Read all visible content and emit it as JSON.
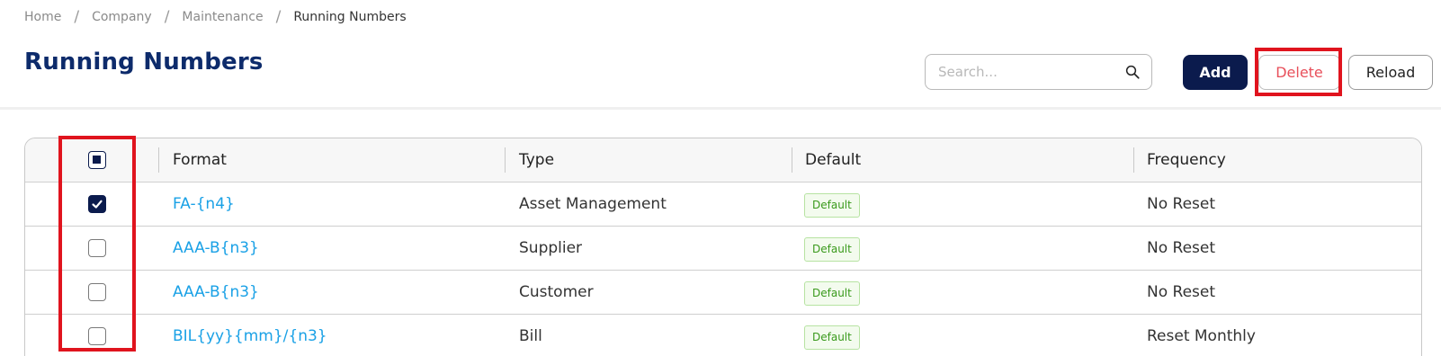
{
  "breadcrumb": {
    "items": [
      "Home",
      "Company",
      "Maintenance",
      "Running Numbers"
    ],
    "separator": "/"
  },
  "page": {
    "title": "Running Numbers"
  },
  "search": {
    "placeholder": "Search...",
    "value": "",
    "icon": "search-icon"
  },
  "toolbar": {
    "add_label": "Add",
    "delete_label": "Delete",
    "reload_label": "Reload"
  },
  "colors": {
    "brand": "#0b1b4d",
    "title": "#0d2b6b",
    "link": "#1aa1e6",
    "danger": "#e8505b",
    "highlight": "#e0141e",
    "badge_text": "#3a9a1c"
  },
  "table": {
    "select_all_state": "indeterminate",
    "columns": [
      "Format",
      "Type",
      "Default",
      "Frequency"
    ],
    "rows": [
      {
        "checked": true,
        "format": "FA-{n4}",
        "type": "Asset Management",
        "default": "Default",
        "frequency": "No Reset"
      },
      {
        "checked": false,
        "format": "AAA-B{n3}",
        "type": "Supplier",
        "default": "Default",
        "frequency": "No Reset"
      },
      {
        "checked": false,
        "format": "AAA-B{n3}",
        "type": "Customer",
        "default": "Default",
        "frequency": "No Reset"
      },
      {
        "checked": false,
        "format": "BIL{yy}{mm}/{n3}",
        "type": "Bill",
        "default": "Default",
        "frequency": "Reset Monthly"
      }
    ]
  }
}
